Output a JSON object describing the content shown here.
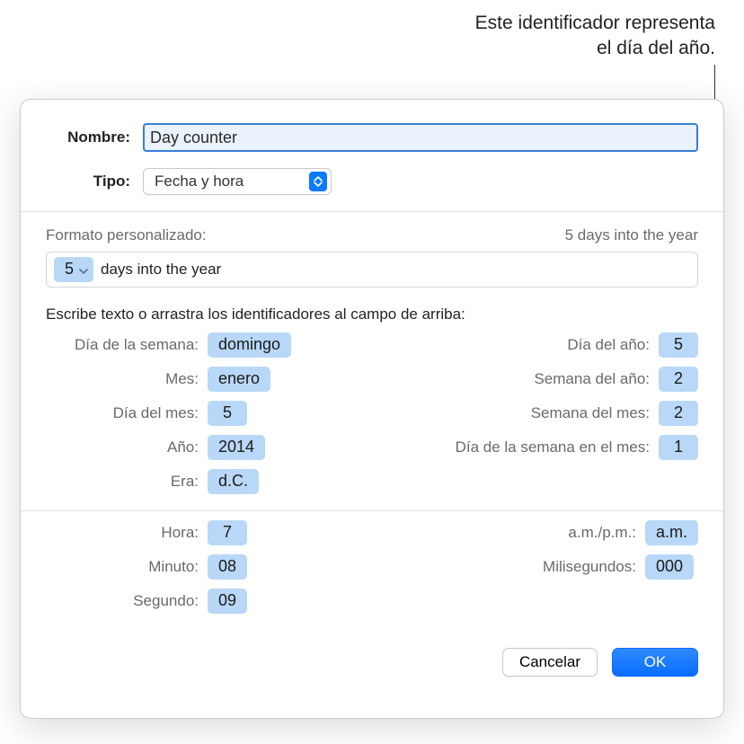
{
  "callout": {
    "line1": "Este identificador representa",
    "line2": "el día del año."
  },
  "fields": {
    "name_label": "Nombre:",
    "name_value": "Day counter",
    "type_label": "Tipo:",
    "type_value": "Fecha y hora"
  },
  "format": {
    "header_label": "Formato personalizado:",
    "header_preview": "5 days into the year",
    "token_value": "5",
    "trailing_text": "days into the year"
  },
  "instructions": "Escribe texto o arrastra los identificadores al campo de arriba:",
  "tokens": {
    "left": [
      {
        "label": "Día de la semana:",
        "value": "domingo",
        "name": "token-weekday"
      },
      {
        "label": "Mes:",
        "value": "enero",
        "name": "token-month"
      },
      {
        "label": "Día del mes:",
        "value": "5",
        "name": "token-day-of-month"
      },
      {
        "label": "Año:",
        "value": "2014",
        "name": "token-year"
      },
      {
        "label": "Era:",
        "value": "d.C.",
        "name": "token-era"
      }
    ],
    "right": [
      {
        "label": "Día del año:",
        "value": "5",
        "name": "token-day-of-year"
      },
      {
        "label": "Semana del año:",
        "value": "2",
        "name": "token-week-of-year"
      },
      {
        "label": "Semana del mes:",
        "value": "2",
        "name": "token-week-of-month"
      },
      {
        "label": "Día de la semana en el mes:",
        "value": "1",
        "name": "token-weekday-in-month"
      }
    ],
    "time_left": [
      {
        "label": "Hora:",
        "value": "7",
        "name": "token-hour"
      },
      {
        "label": "Minuto:",
        "value": "08",
        "name": "token-minute"
      },
      {
        "label": "Segundo:",
        "value": "09",
        "name": "token-second"
      }
    ],
    "time_right": [
      {
        "label": "a.m./p.m.:",
        "value": "a.m.",
        "name": "token-ampm"
      },
      {
        "label": "Milisegundos:",
        "value": "000",
        "name": "token-milliseconds"
      }
    ]
  },
  "buttons": {
    "cancel": "Cancelar",
    "ok": "OK"
  }
}
